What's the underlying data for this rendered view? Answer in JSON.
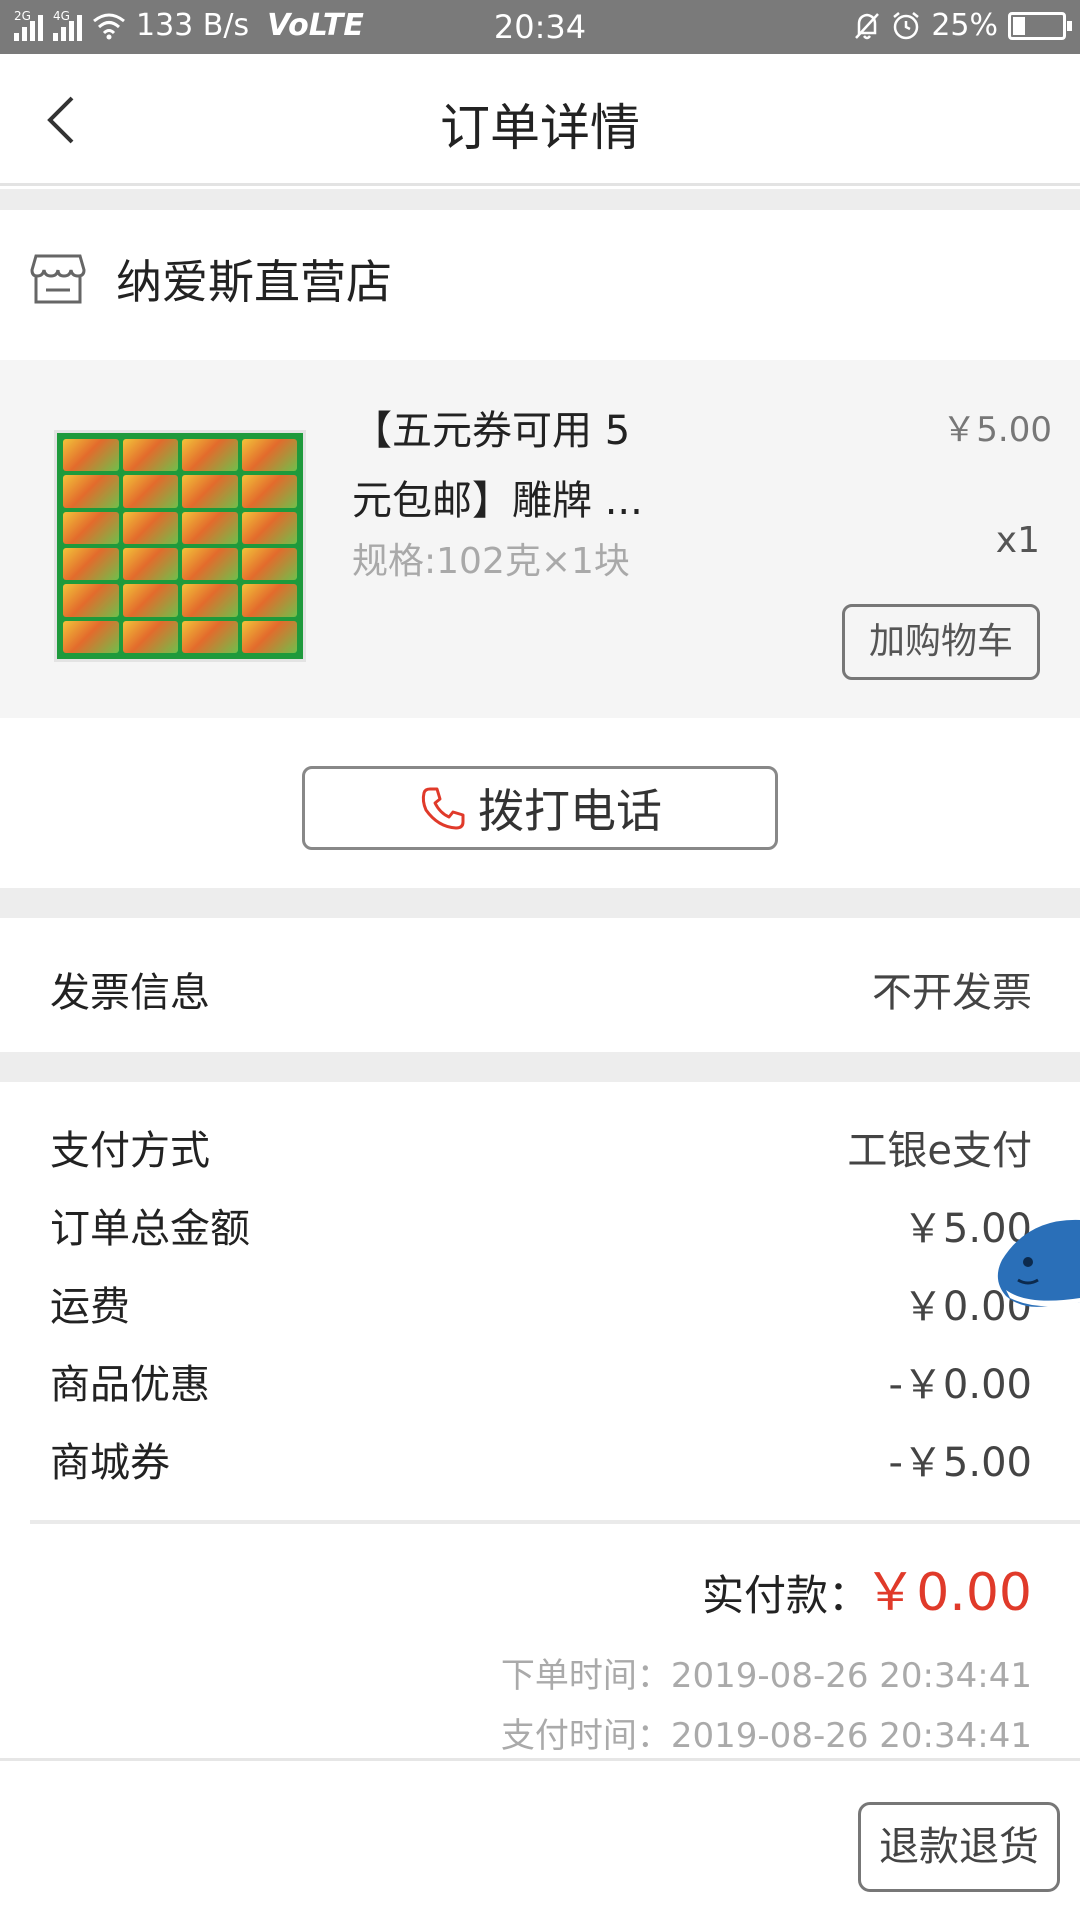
{
  "status_bar": {
    "net_speed": "133 B/s",
    "volte": "VoLTE",
    "time": "20:34",
    "battery": "25%",
    "battery_level": 0.25,
    "sim1": "2G",
    "sim2": "4G"
  },
  "header": {
    "title": "订单详情",
    "back_icon": "chevron-left-icon"
  },
  "shop": {
    "name": "纳爱斯直营店",
    "icon": "store-icon"
  },
  "product": {
    "name": "【五元券可用 5 元包邮】雕牌 ...",
    "spec": "规格:102克×1块",
    "price": "￥5.00",
    "quantity": "x1",
    "add_cart_label": "加购物车"
  },
  "call": {
    "label": "拨打电话",
    "icon": "phone-icon"
  },
  "invoice": {
    "label": "发票信息",
    "value": "不开发票"
  },
  "payment": {
    "rows": [
      {
        "label": "支付方式",
        "value": "工银e支付"
      },
      {
        "label": "订单总金额",
        "value": "￥5.00"
      },
      {
        "label": "运费",
        "value": "￥0.00"
      },
      {
        "label": "商品优惠",
        "value": "-￥0.00"
      },
      {
        "label": "商城券",
        "value": "-￥5.00"
      }
    ],
    "total_label": "实付款：",
    "total_value": "￥0.00",
    "order_time": "下单时间：2019-08-26 20:34:41",
    "pay_time": "支付时间：2019-08-26 20:34:41"
  },
  "refund_label": "退款退货",
  "colors": {
    "accent_red": "#e03a2a",
    "status_bar": "#7a7a7a",
    "section_gap": "#ededed"
  }
}
